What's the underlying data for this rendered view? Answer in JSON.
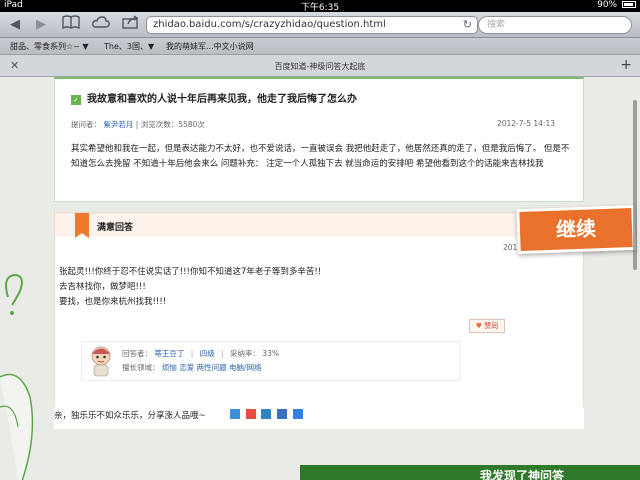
{
  "status_bar": {
    "device": "iPad",
    "time": "下午6:35",
    "battery": "90%"
  },
  "toolbar": {
    "url": "zhidao.baidu.com/s/crazyzhidao/question.html",
    "search_placeholder": "搜索"
  },
  "bookmarks": [
    "甜品、零食系列☆~ ▼",
    "The、3国、▼",
    "我的萌妹军...中文小说网"
  ],
  "tab": {
    "title": "百度知道-神级问答大起底"
  },
  "question": {
    "title": "我故意和喜欢的人说十年后再来见我，他走了我后悔了怎么办",
    "asker_label": "提问者：",
    "asker": "紫尹若月",
    "views": "| 浏览次数：5580次",
    "date": "2012-7-5 14:13",
    "body": "其实希望他和我在一起，但是表达能力不太好，也不爱说话，一直被误会 我把他赶走了，他居然还真的走了，但是我后悔了。 但是不知道怎么去挽留 不知道十年后他会来么 问题补充： 注定一个人孤独下去 就当命运的安排吧 希望他看到这个的话能来吉林找我"
  },
  "answer": {
    "header": "满意回答",
    "date": "2012-7-5 23:00",
    "lines": [
      "张起灵!!!你终于忍不住说实话了!!!你知不知道这7年老子等到多辛苦!!",
      "去吉林找你，做梦吧!!!",
      "要找，也是你来杭州找我!!!!"
    ],
    "like_label": "赞同",
    "answerer_label": "回答者：",
    "answerer": "蒂王豆丁",
    "level": "四级",
    "adopt_rate_label": "采纳率：",
    "adopt_rate": "33%",
    "expertise_label": "擅长领域：",
    "expertise": [
      "烦恼",
      "恋爱",
      "两性问题",
      "电脑/网络"
    ]
  },
  "share": {
    "text": "亲，独乐乐不如众乐乐，分享涨人品哦~"
  },
  "continue_button": "继续",
  "bottom_banner": "我发现了神问答",
  "colors": {
    "accent_green": "#68b34c",
    "accent_orange": "#e9712b",
    "link_blue": "#2d64b3"
  }
}
